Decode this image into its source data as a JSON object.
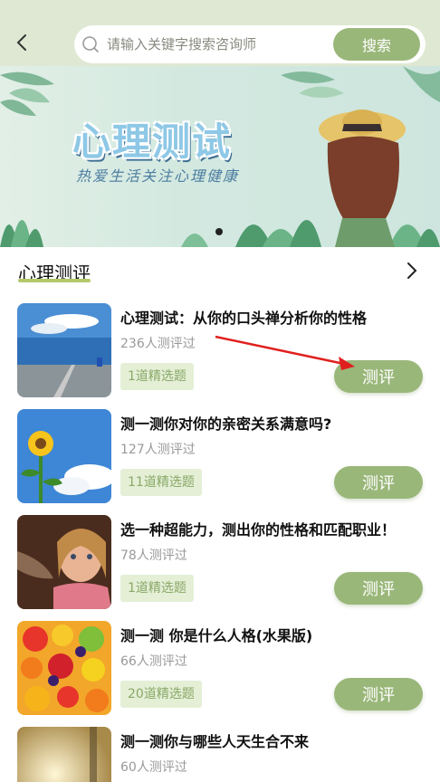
{
  "header": {
    "search_placeholder": "请输入关键字搜索咨询师",
    "search_button": "搜索"
  },
  "banner": {
    "title": "心理测试",
    "subtitle": "热爱生活关注心理健康"
  },
  "section": {
    "title": "心理测评"
  },
  "items": [
    {
      "title": "心理测试：从你的口头禅分析你的性格",
      "count": "236人测评过",
      "tag": "1道精选题",
      "button": "测评",
      "image": "sea-road"
    },
    {
      "title": "测一测你对你的亲密关系满意吗?",
      "count": "127人测评过",
      "tag": "11道精选题",
      "button": "测评",
      "image": "sunflower"
    },
    {
      "title": "选一种超能力，测出你的性格和匹配职业！",
      "count": "78人测评过",
      "tag": "1道精选题",
      "button": "测评",
      "image": "child"
    },
    {
      "title": "测一测 你是什么人格(水果版)",
      "count": "66人测评过",
      "tag": "20道精选题",
      "button": "测评",
      "image": "fruits"
    },
    {
      "title": "测一测你与哪些人天生合不来",
      "count": "60人测评过",
      "tag": "",
      "button": "",
      "image": "sunlight-forest"
    }
  ],
  "colors": {
    "header_bg": "#dfe8d2",
    "accent": "#9ab77a",
    "tag_bg": "#e4efd6",
    "annotation_arrow": "#e0201e"
  }
}
